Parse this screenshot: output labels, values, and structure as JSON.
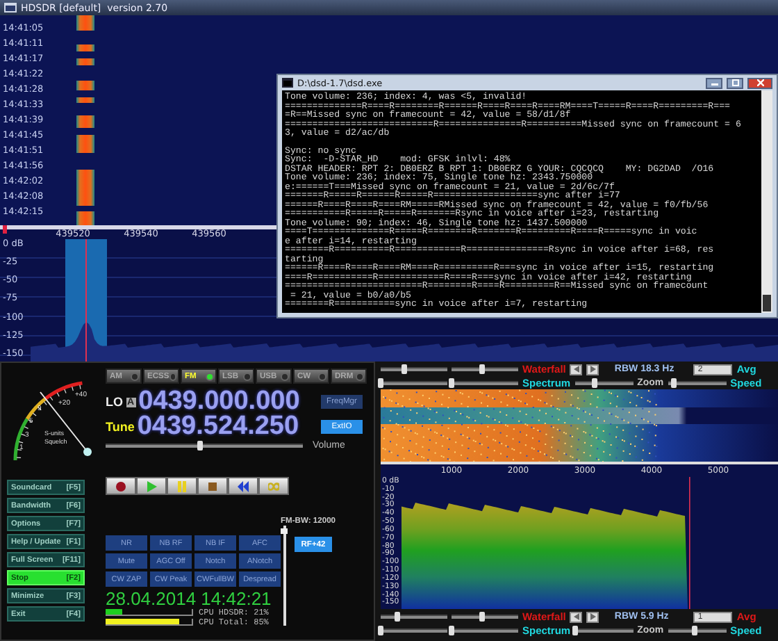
{
  "window": {
    "title": "HDSDR [default]  version 2.70"
  },
  "waterfall": {
    "times": [
      "14:41:05",
      "14:41:11",
      "14:41:17",
      "14:41:22",
      "14:41:28",
      "14:41:33",
      "14:41:39",
      "14:41:45",
      "14:41:51",
      "14:41:56",
      "14:42:02",
      "14:42:08",
      "14:42:15"
    ]
  },
  "freq_axis": {
    "labels": [
      "439520",
      "439540",
      "439560"
    ]
  },
  "spectrum": {
    "db_labels": [
      "0 dB",
      "-25",
      "-50",
      "-75",
      "-100",
      "-125",
      "-150"
    ]
  },
  "console": {
    "title": "D:\\dsd-1.7\\dsd.exe",
    "blocks": [
      [
        "Tone volume: 236; index: 4, was <5, invalid!",
        "==============R====R========R======R====R====R====RM====T=====R====R=========R===",
        "=R==Missed sync on framecount = 42, value = 58/d1/8f",
        "===========================R===============R==========Missed sync on framecount = 6",
        "3, value = d2/ac/db"
      ],
      [
        "Sync: no sync",
        "Sync:  -D-STAR_HD    mod: GFSK inlvl: 48%",
        "DSTAR HEADER: RPT 2: DB0ERZ B RPT 1: DB0ERZ G YOUR: CQCQCQ    MY: DG2DAD  /O16",
        "Tone volume: 236; index: 75, Single tone hz: 2343.750000",
        "e:======T===Missed sync on framecount = 21, value = 2d/6c/7f",
        "=======R=====R======R=====R===================sync after i=77",
        "======R====R====R====RM=====RMissed sync on framecount = 42, value = f0/fb/56",
        "===========R=====R=====R=======Rsync in voice after i=23, restarting",
        "Tone volume: 90; index: 46, Single tone hz: 1437.500000",
        "====T==============R=====R========R=======R=========R====R=====sync in voic",
        "e after i=14, restarting",
        "========R==========R============R===============Rsync in voice after i=68, res",
        "tarting",
        "======R====R====R====RM====R==========R===sync in voice after i=15, restarting",
        "====R===========R============R====R===sync in voice after i=42, restarting",
        "=========================R========R====R=========R==Missed sync on framecount",
        " = 21, value = b0/a0/b5",
        "========R===========sync in voice after i=7, restarting"
      ]
    ]
  },
  "smeter": {
    "labels": [
      "+40",
      "+20",
      "9",
      "5",
      "3",
      "1",
      "S-units",
      "Squelch"
    ]
  },
  "modes": [
    {
      "label": "AM",
      "selected": false
    },
    {
      "label": "ECSS",
      "selected": false
    },
    {
      "label": "FM",
      "selected": true
    },
    {
      "label": "LSB",
      "selected": false
    },
    {
      "label": "USB",
      "selected": false
    },
    {
      "label": "CW",
      "selected": false
    },
    {
      "label": "DRM",
      "selected": false
    }
  ],
  "lo": {
    "label": "LO",
    "vfo": "A",
    "frequency": "0439.000.000",
    "button": {
      "label": "FreqMgr",
      "active": false
    }
  },
  "tune": {
    "label": "Tune",
    "frequency": "0439.524.250",
    "button": {
      "label": "ExtIO",
      "active": true
    }
  },
  "volume": {
    "label": "Volume",
    "level": 0.48
  },
  "side_buttons": [
    {
      "label": "Soundcard",
      "key": "[F5]",
      "active": false
    },
    {
      "label": "Bandwidth",
      "key": "[F6]",
      "active": false
    },
    {
      "label": "Options",
      "key": "[F7]",
      "active": false
    },
    {
      "label": "Help / Update",
      "key": "[F1]",
      "active": false
    },
    {
      "label": "Full Screen",
      "key": "[F11]",
      "active": false
    },
    {
      "label": "Stop",
      "key": "[F2]",
      "active": true
    },
    {
      "label": "Minimize",
      "key": "[F3]",
      "active": false
    },
    {
      "label": "Exit",
      "key": "[F4]",
      "active": false
    }
  ],
  "fm_bw": {
    "label": "FM-BW: 12000",
    "level": 0.97
  },
  "dsp_buttons": [
    "NR",
    "NB RF",
    "NB IF",
    "AFC",
    "Mute",
    "AGC Off",
    "Notch",
    "ANotch",
    "CW ZAP",
    "CW Peak",
    "CWFullBW",
    "Despread"
  ],
  "rf_gain": {
    "label": "RF+42",
    "active": true
  },
  "datetime": "28.04.2014 14:42:21",
  "cpu": [
    {
      "label": "CPU HDSDR:",
      "reading": "21%",
      "level": 0.2
    },
    {
      "label": "CPU Total:",
      "reading": "85%",
      "level": 0.85
    }
  ],
  "audio": {
    "controls": [
      {
        "waterfall_label": "Waterfall",
        "rbw": "RBW 18.3 Hz",
        "avg_value": "2",
        "avg_label": "Avg",
        "avg_on": false,
        "spectrum_label": "Spectrum",
        "zoom_label": "Zoom",
        "speed_label": "Speed",
        "sliders": [
          {
            "level": 0.35
          },
          {
            "level": 0.45
          },
          {
            "level": 0.0
          },
          {
            "level": 0.0
          },
          {
            "level": 0.35
          },
          {
            "level": 0.1
          }
        ]
      },
      {
        "waterfall_label": "Waterfall",
        "rbw": "RBW 5.9 Hz",
        "avg_value": "1",
        "avg_label": "Avg",
        "avg_on": true,
        "spectrum_label": "Spectrum",
        "zoom_label": "Zoom",
        "speed_label": "Speed",
        "sliders": [
          {
            "level": 0.25
          },
          {
            "level": 0.45
          },
          {
            "level": 0.0
          },
          {
            "level": 0.0
          },
          {
            "level": 0.0
          },
          {
            "level": 0.45
          }
        ]
      }
    ],
    "axis_labels": [
      "1000",
      "2000",
      "3000",
      "4000",
      "5000"
    ],
    "db_labels": [
      "0 dB",
      "-10",
      "-20",
      "-30",
      "-40",
      "-50",
      "-60",
      "-70",
      "-80",
      "-90",
      "-100",
      "-110",
      "-120",
      "-130",
      "-140",
      "-150"
    ]
  }
}
